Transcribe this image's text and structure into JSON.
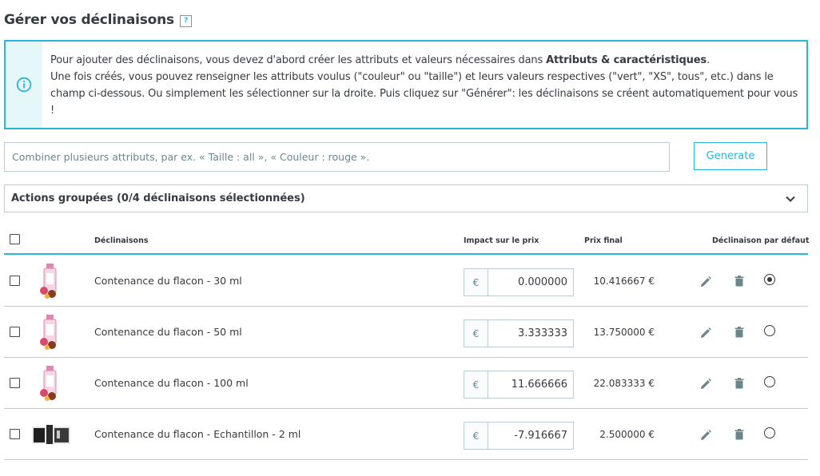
{
  "page": {
    "title": "Gérer vos déclinaisons",
    "help_glyph": "?"
  },
  "alert": {
    "icon": "info-icon",
    "line1_pre": "Pour ajouter des déclinaisons, vous devez d'abord créer les attributs et valeurs nécessaires dans ",
    "line1_bold": "Attributs & caractéristiques",
    "line1_post": ".",
    "line2": "Une fois créés, vous pouvez renseigner les attributs voulus (\"couleur\" ou \"taille\") et leurs valeurs respectives (\"vert\", \"XS\", tous\", etc.) dans le champ ci-dessous. Ou simplement les sélectionner sur la droite. Puis cliquez sur \"Générer\": les déclinaisons se créent automatiquement pour vous !"
  },
  "combine": {
    "placeholder": "Combiner plusieurs attributs, par ex. « Taille : all », « Couleur : rouge ».",
    "value": ""
  },
  "generate_button": "Generate",
  "bulk_actions": {
    "label": "Actions groupées (0/4 déclinaisons sélectionnées)",
    "icon": "chevron-down-icon"
  },
  "table": {
    "headers": {
      "declinaisons": "Déclinaisons",
      "impact": "Impact sur le prix",
      "final": "Prix final",
      "default": "Déclinaison par défaut"
    },
    "currency": "€",
    "rows": [
      {
        "name": "Contenance du flacon - 30 ml",
        "impact": "0.000000",
        "final": "10.416667 €",
        "default": true,
        "thumb": "perfume-bottle"
      },
      {
        "name": "Contenance du flacon - 50 ml",
        "impact": "3.333333",
        "final": "13.750000 €",
        "default": false,
        "thumb": "perfume-bottle"
      },
      {
        "name": "Contenance du flacon - 100 ml",
        "impact": "11.666666",
        "final": "22.083333 €",
        "default": false,
        "thumb": "perfume-bottle"
      },
      {
        "name": "Contenance du flacon - Echantillon - 2 ml",
        "impact": "-7.916667",
        "final": "2.500000 €",
        "default": false,
        "thumb": "sample-box"
      }
    ]
  },
  "colors": {
    "accent": "#25b9d7",
    "border": "#bbcdd2",
    "text": "#363a41",
    "info_bg": "#e6f7fa"
  }
}
